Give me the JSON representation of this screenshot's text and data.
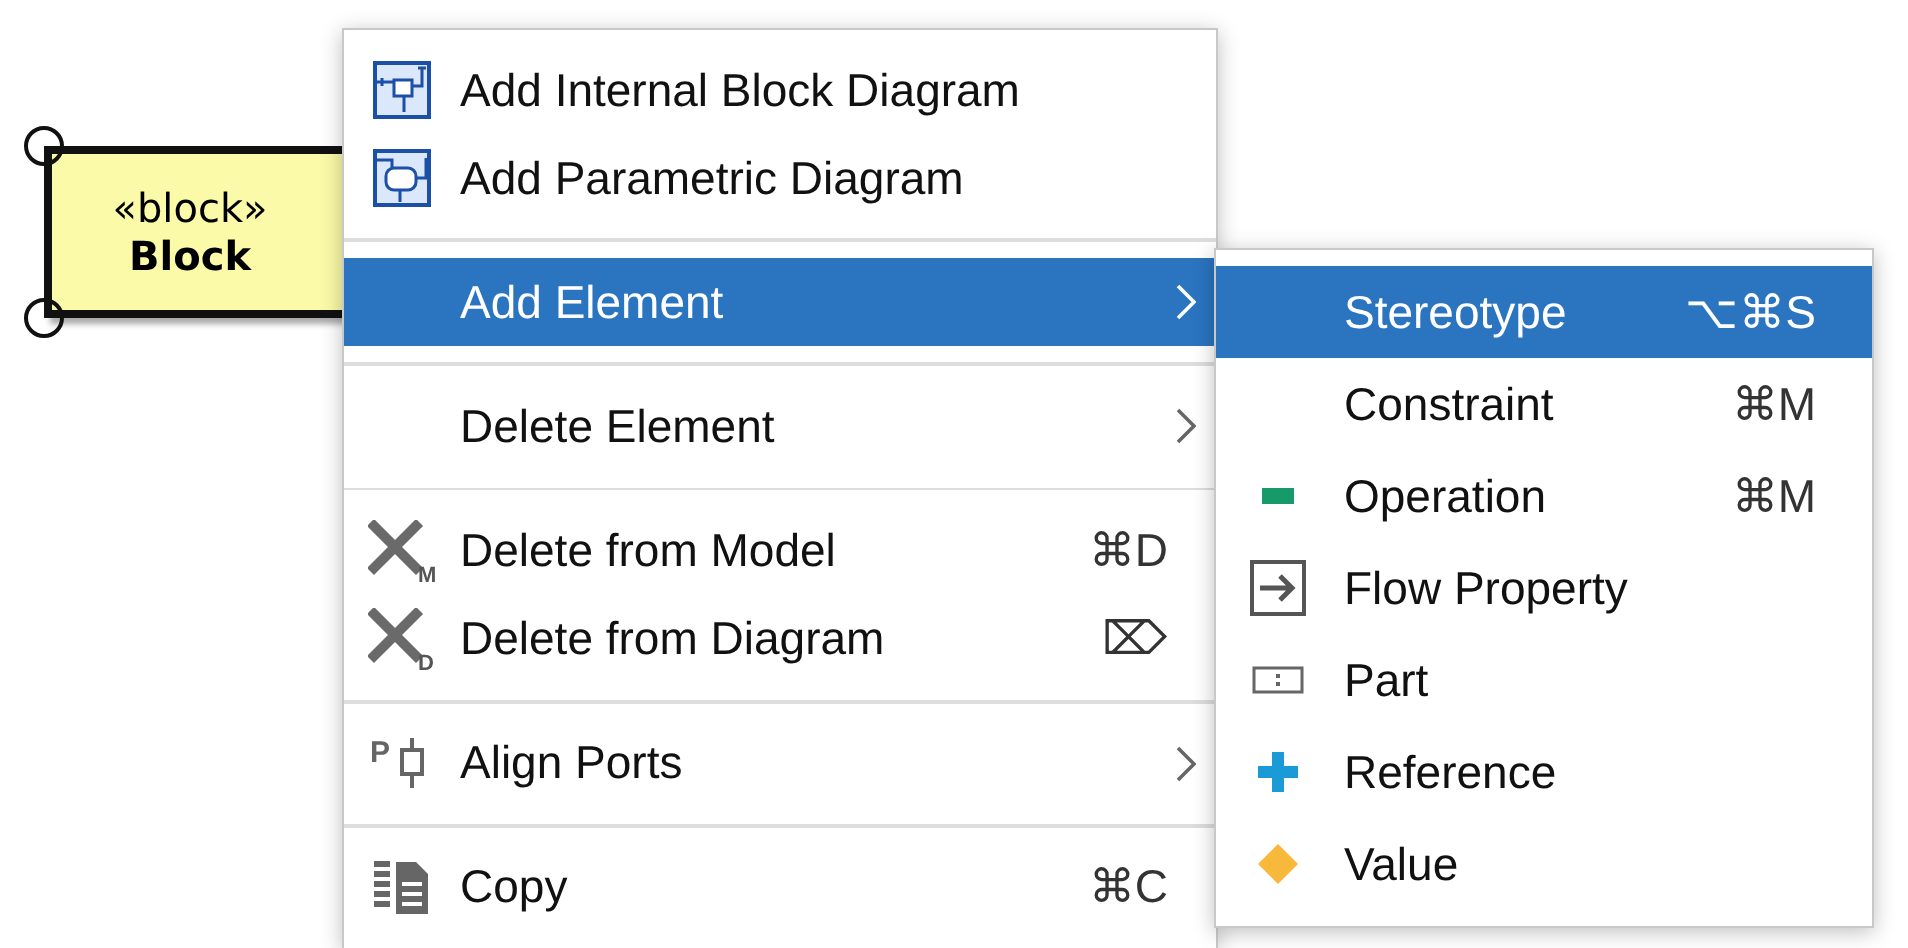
{
  "block": {
    "stereotype": "«block»",
    "name": "Block"
  },
  "context_menu": {
    "items": [
      {
        "kind": "internal-block-diagram",
        "label": "Add Internal Block Diagram",
        "selected": false
      },
      {
        "kind": "parametric-diagram",
        "label": "Add Parametric Diagram",
        "selected": false
      },
      {
        "kind": "separator"
      },
      {
        "kind": "plain",
        "label": "Add Element",
        "selected": true,
        "submenu": true
      },
      {
        "kind": "separator"
      },
      {
        "kind": "plain",
        "label": "Delete Element",
        "selected": false,
        "submenu": true
      },
      {
        "kind": "separator"
      },
      {
        "kind": "delete",
        "icon_letter": "M",
        "label": "Delete from Model",
        "shortcut": "⌘D",
        "selected": false
      },
      {
        "kind": "delete",
        "icon_letter": "D",
        "label": "Delete from Diagram",
        "shortcut": "⌦",
        "selected": false
      },
      {
        "kind": "separator"
      },
      {
        "kind": "ports",
        "icon_letter": "P",
        "label": "Align Ports",
        "selected": false,
        "submenu": true
      },
      {
        "kind": "separator"
      },
      {
        "kind": "copy",
        "label": "Copy",
        "shortcut": "⌘C",
        "selected": false
      }
    ]
  },
  "submenu": {
    "items": [
      {
        "kind": "plain",
        "label": "Stereotype",
        "shortcut": "⌥⌘S",
        "selected": true
      },
      {
        "kind": "plain",
        "label": "Constraint",
        "shortcut": "⌘M",
        "selected": false
      },
      {
        "kind": "operation",
        "label": "Operation",
        "shortcut": "⌘M",
        "selected": false
      },
      {
        "kind": "flow-property",
        "label": "Flow Property",
        "selected": false
      },
      {
        "kind": "part",
        "label": "Part",
        "selected": false
      },
      {
        "kind": "reference",
        "label": "Reference",
        "selected": false
      },
      {
        "kind": "value",
        "label": "Value",
        "selected": false
      }
    ]
  }
}
